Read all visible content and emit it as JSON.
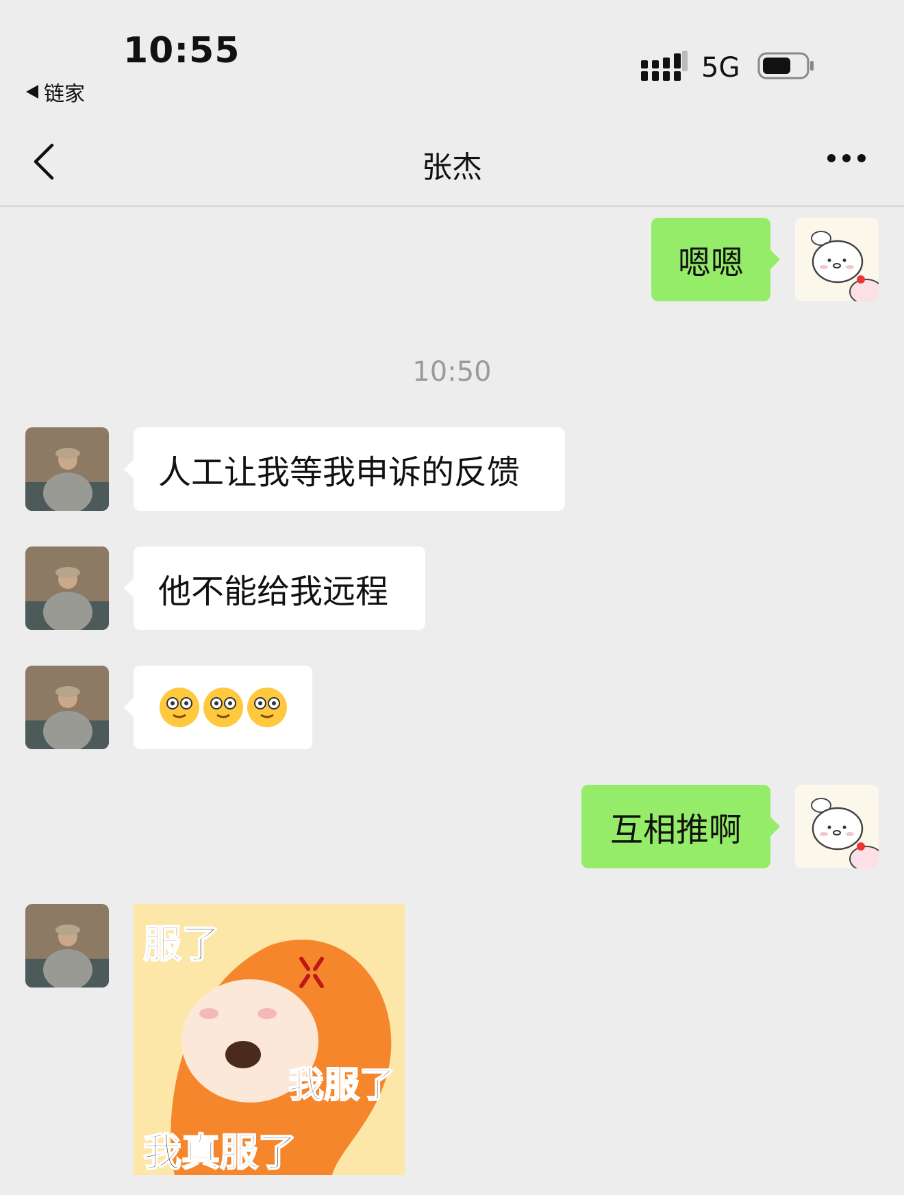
{
  "status_bar": {
    "time": "10:55",
    "back_app_label": "链家",
    "network": "5G"
  },
  "nav": {
    "title": "张杰"
  },
  "messages": [
    {
      "side": "out",
      "text": "嗯嗯"
    },
    {
      "side": "timestamp",
      "text": "10:50"
    },
    {
      "side": "in",
      "text": "人工让我等我申诉的反馈"
    },
    {
      "side": "in",
      "text": "他不能给我远程"
    },
    {
      "side": "in",
      "emoji": [
        "face-with-spiral-eyes",
        "face-with-spiral-eyes",
        "face-with-spiral-eyes"
      ]
    },
    {
      "side": "out",
      "text": "互相推啊"
    },
    {
      "side": "in",
      "sticker_text": [
        "服了",
        "我服了",
        "我真服了"
      ]
    }
  ],
  "colors": {
    "background": "#ededed",
    "outgoing_bubble": "#95ec69",
    "incoming_bubble": "#ffffff",
    "timestamp": "#9a9a9a"
  }
}
